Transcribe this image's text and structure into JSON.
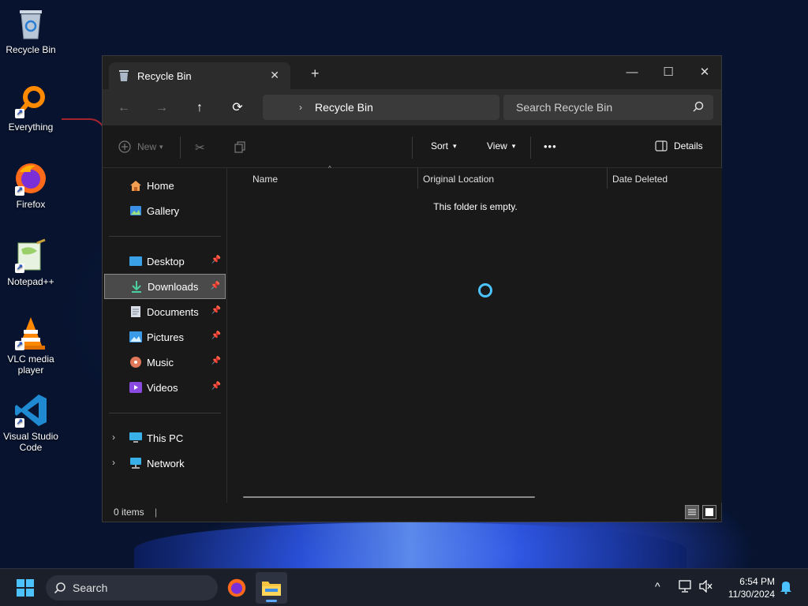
{
  "desktop": {
    "icons": [
      {
        "label": "Recycle Bin"
      },
      {
        "label": "Everything"
      },
      {
        "label": "Firefox"
      },
      {
        "label": "Notepad++"
      },
      {
        "label": "VLC media player"
      },
      {
        "label": "Visual Studio Code"
      }
    ]
  },
  "window": {
    "tab_title": "Recycle Bin",
    "close_tab_glyph": "✕",
    "new_tab_glyph": "+",
    "controls": {
      "minimize": "—",
      "maximize": "☐",
      "close": "✕"
    },
    "nav": {
      "back": "←",
      "forward": "→",
      "up": "↑",
      "refresh": "⟳"
    },
    "address": {
      "chevron": "›",
      "crumb": "Recycle Bin"
    },
    "search_placeholder": "Search Recycle Bin",
    "command_bar": {
      "new_label": "New",
      "sort_label": "Sort",
      "view_label": "View",
      "more_glyph": "•••",
      "details_label": "Details"
    },
    "sidebar": {
      "quick": [
        {
          "label": "Home"
        },
        {
          "label": "Gallery"
        }
      ],
      "pinned": [
        {
          "label": "Desktop"
        },
        {
          "label": "Downloads"
        },
        {
          "label": "Documents"
        },
        {
          "label": "Pictures"
        },
        {
          "label": "Music"
        },
        {
          "label": "Videos"
        }
      ],
      "locations": [
        {
          "label": "This PC"
        },
        {
          "label": "Network"
        }
      ],
      "selected": "Downloads",
      "expander_glyph": "›"
    },
    "columns": {
      "name": "Name",
      "original_location": "Original Location",
      "date_deleted": "Date Deleted"
    },
    "empty_message": "This folder is empty.",
    "status": {
      "items": "0 items",
      "cursor": "|"
    }
  },
  "taskbar": {
    "search_label": "Search",
    "time": "6:54 PM",
    "date": "11/30/2024",
    "tray_chevron": "^"
  },
  "colors": {
    "accent": "#4cc2ff",
    "window_bg": "#191919",
    "titlebar_bg": "#202020",
    "navbar_bg": "#2c2c2c",
    "taskbar_bg": "#1b1f2a"
  }
}
